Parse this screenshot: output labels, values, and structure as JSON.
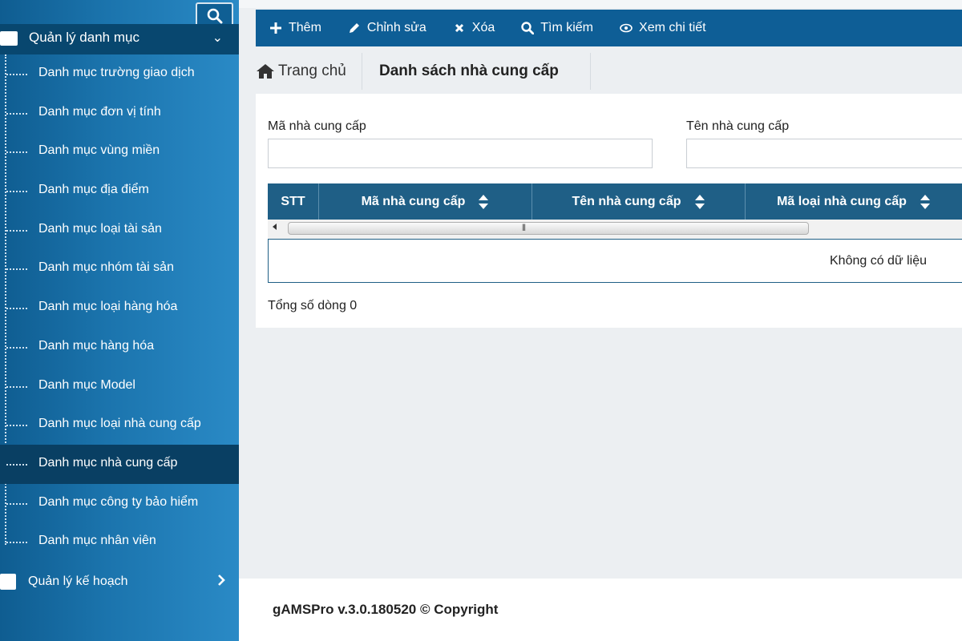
{
  "sidebar": {
    "parent_label": "Quản lý danh mục",
    "items": [
      {
        "label": "Danh mục trường giao dịch"
      },
      {
        "label": "Danh mục đơn vị tính"
      },
      {
        "label": "Danh mục vùng miền"
      },
      {
        "label": "Danh mục địa điểm"
      },
      {
        "label": "Danh mục loại tài sản"
      },
      {
        "label": "Danh mục nhóm tài sản"
      },
      {
        "label": "Danh mục loại hàng hóa"
      },
      {
        "label": "Danh mục hàng hóa"
      },
      {
        "label": "Danh mục Model"
      },
      {
        "label": "Danh mục loại nhà cung cấp"
      },
      {
        "label": "Danh mục nhà cung cấp",
        "active": true
      },
      {
        "label": "Danh mục công ty bảo hiểm"
      },
      {
        "label": "Danh mục nhân viên"
      }
    ],
    "plan_label": "Quản lý kế hoạch"
  },
  "toolbar": {
    "add": "Thêm",
    "edit": "Chỉnh sửa",
    "delete": "Xóa",
    "search": "Tìm kiếm",
    "view": "Xem chi tiết"
  },
  "breadcrumb": {
    "home": "Trang chủ",
    "current": "Danh sách nhà cung cấp"
  },
  "filters": {
    "code_label": "Mã nhà cung cấp",
    "code_value": "",
    "name_label": "Tên nhà cung cấp",
    "name_value": ""
  },
  "grid": {
    "columns": [
      "STT",
      "Mã nhà cung cấp",
      "Tên nhà cung cấp",
      "Mã loại nhà cung cấp"
    ],
    "empty_text": "Không có dữ liệu",
    "total_text": "Tổng số dòng 0"
  },
  "footer": {
    "text": "gAMSPro v.3.0.180520 © Copyright"
  },
  "colors": {
    "toolbar": "#0e5e96",
    "grid_header": "#1f5f86",
    "sidebar_active": "#093f63"
  }
}
